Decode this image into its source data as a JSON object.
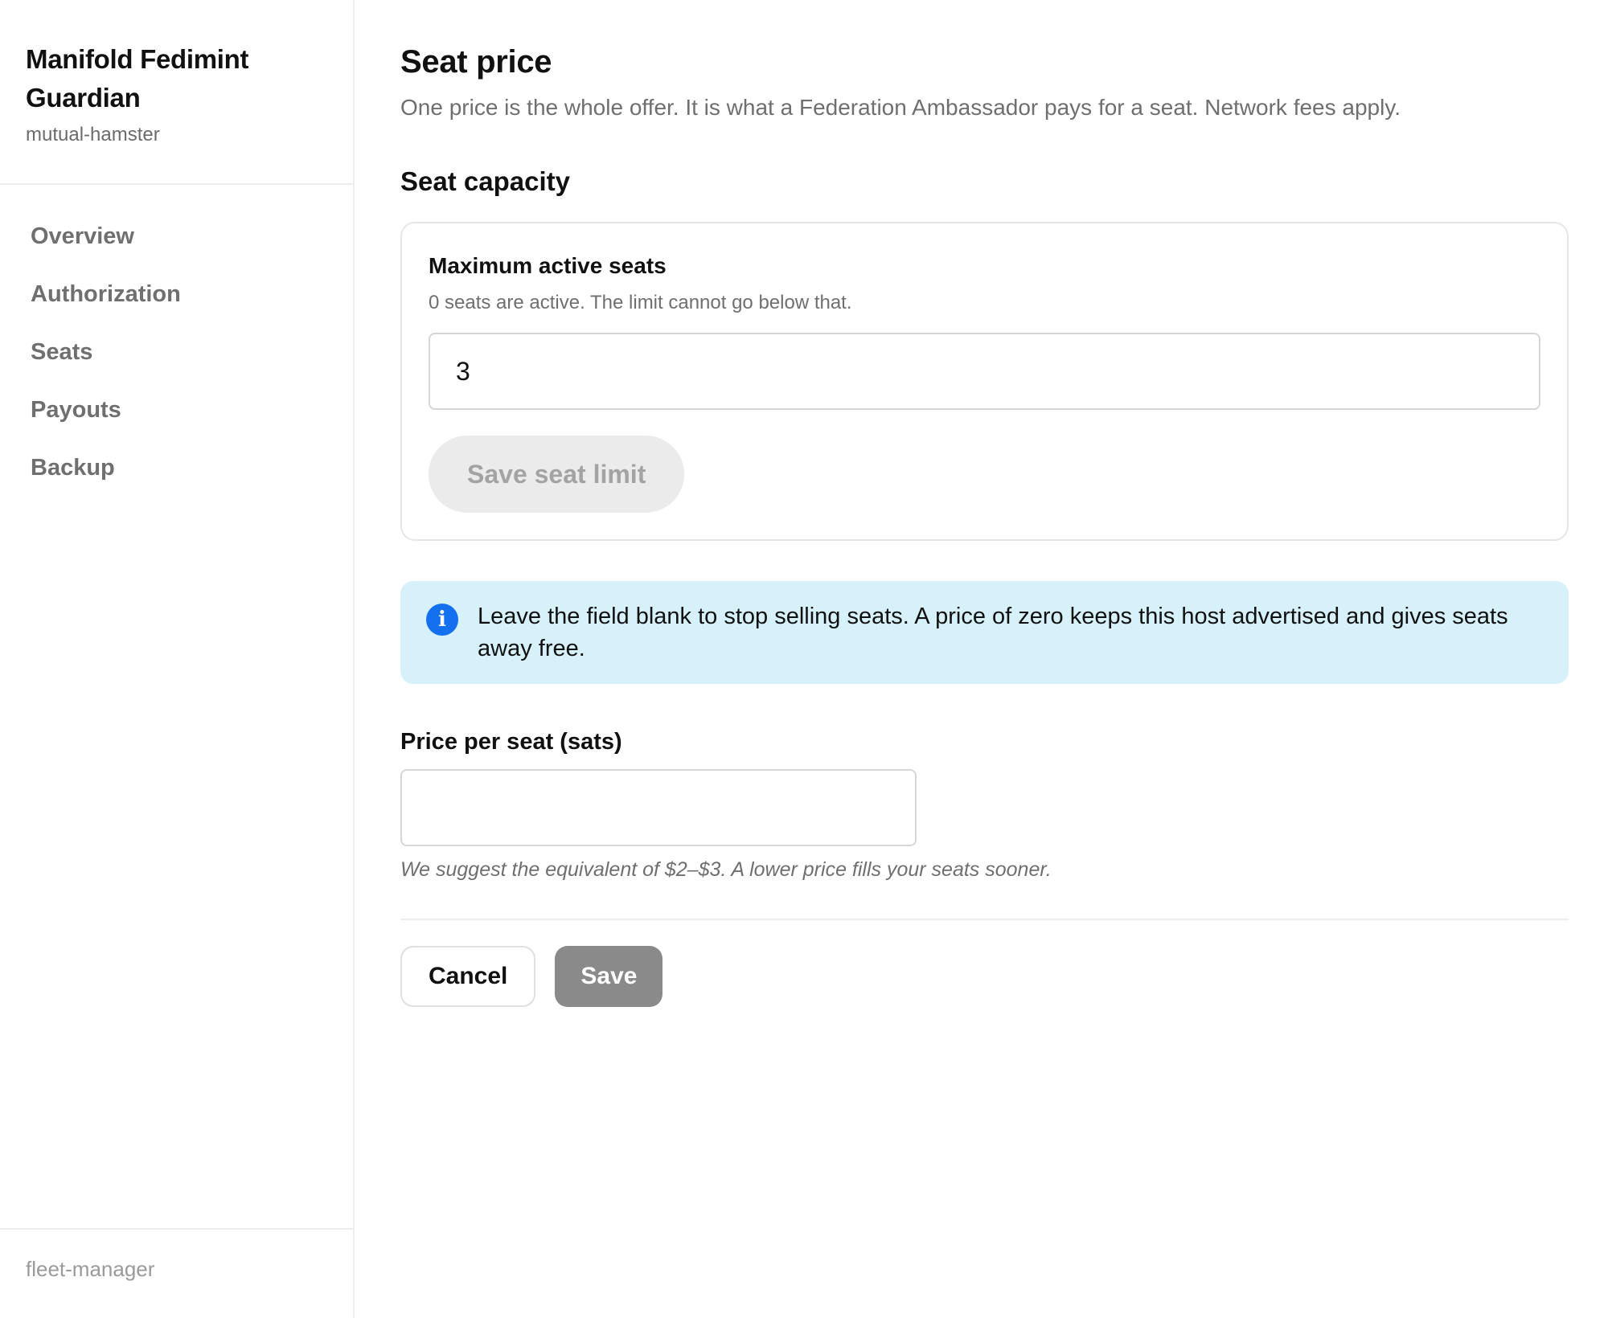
{
  "sidebar": {
    "app_title": "Manifold Fedimint Guardian",
    "app_subtitle": "mutual-hamster",
    "nav": [
      {
        "label": "Overview"
      },
      {
        "label": "Authorization"
      },
      {
        "label": "Seats"
      },
      {
        "label": "Payouts"
      },
      {
        "label": "Backup"
      }
    ],
    "footer": "fleet-manager"
  },
  "main": {
    "title": "Seat price",
    "description": "One price is the whole offer. It is what a Federation Ambassador pays for a seat. Network fees apply.",
    "seat_capacity": {
      "section_title": "Seat capacity",
      "card_title": "Maximum active seats",
      "help": "0 seats are active. The limit cannot go below that.",
      "value": "3",
      "save_label": "Save seat limit"
    },
    "info": {
      "icon": "info-icon",
      "icon_glyph": "i",
      "text": "Leave the field blank to stop selling seats. A price of zero keeps this host advertised and gives seats away free."
    },
    "price": {
      "label": "Price per seat (sats)",
      "value": "",
      "hint": "We suggest the equivalent of $2–$3. A lower price fills your seats sooner."
    },
    "actions": {
      "cancel_label": "Cancel",
      "save_label": "Save"
    }
  },
  "colors": {
    "info_bg": "#d7f1fb",
    "info_icon": "#1570ef",
    "save_button": "#8a8a8a",
    "disabled_button": "#ebebeb"
  }
}
